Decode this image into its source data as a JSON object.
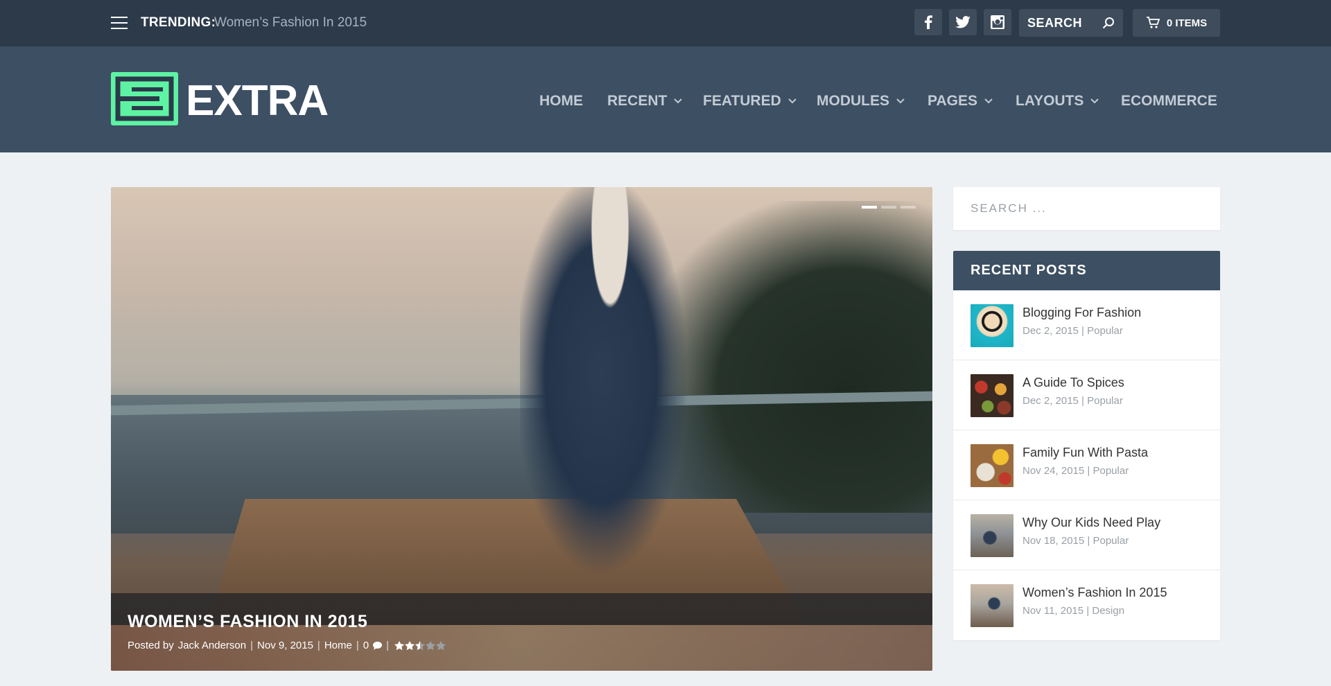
{
  "topbar": {
    "trending_label": "TRENDING:",
    "trending_link": "Women’s Fashion In 2015",
    "social": [
      "facebook-icon",
      "twitter-icon",
      "instagram-icon"
    ],
    "search_placeholder": "SEARCH",
    "cart_label": "0 ITEMS"
  },
  "header": {
    "logo_text": "EXTRA",
    "nav": [
      "HOME",
      "RECENT",
      "FEATURED",
      "MODULES",
      "PAGES",
      "LAYOUTS",
      "ECOMMERCE"
    ]
  },
  "hero": {
    "title": "WOMEN’S FASHION IN 2015",
    "meta": {
      "posted_by_prefix": "Posted by",
      "author": "Jack Anderson",
      "date": "Nov 9, 2015",
      "category": "Home",
      "comments": "0"
    },
    "rating_stars": 2.5,
    "slides": 3
  },
  "sidebar": {
    "search_placeholder": "SEARCH ...",
    "recent_title": "RECENT POSTS",
    "posts": [
      {
        "title": "Blogging For Fashion",
        "date": "Dec 2, 2015",
        "category": "Popular"
      },
      {
        "title": "A Guide To Spices",
        "date": "Dec 2, 2015",
        "category": "Popular"
      },
      {
        "title": "Family Fun With Pasta",
        "date": "Nov 24, 2015",
        "category": "Popular"
      },
      {
        "title": "Why Our Kids Need Play",
        "date": "Nov 18, 2015",
        "category": "Popular"
      },
      {
        "title": "Women’s Fashion In 2015",
        "date": "Nov 11, 2015",
        "category": "Design"
      }
    ]
  },
  "colors": {
    "topbar": "#2c3a4a",
    "header": "#3d4f63",
    "accent": "#5ef3a3",
    "background": "#eef1f4"
  }
}
